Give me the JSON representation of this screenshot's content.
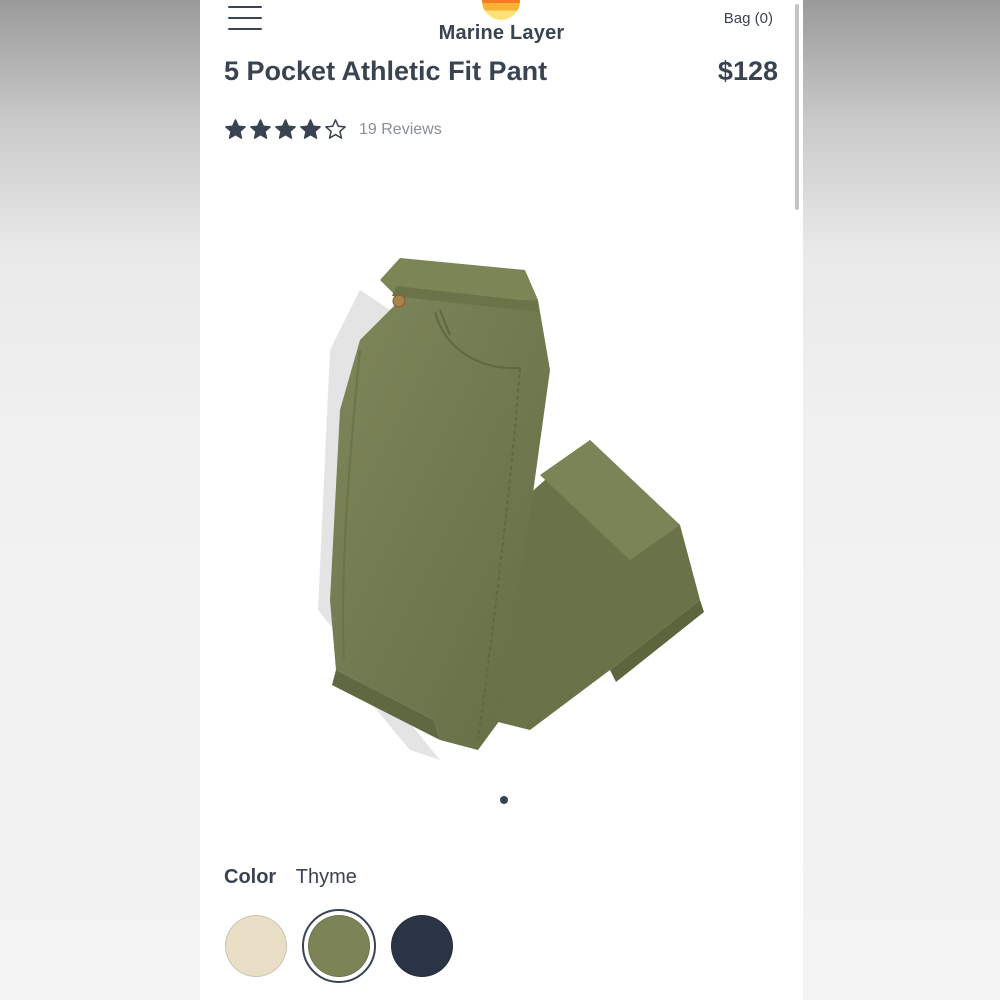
{
  "header": {
    "brand": "Marine Layer",
    "bag_label": "Bag (0)",
    "logo_colors": [
      "#e2322a",
      "#f47b22",
      "#f9b233",
      "#fde27a"
    ]
  },
  "product": {
    "title": "5 Pocket Athletic Fit Pant",
    "price": "$128",
    "rating": 4,
    "rating_max": 5,
    "reviews_label": "19 Reviews",
    "image_count": 1,
    "current_image": 1
  },
  "color": {
    "label": "Color",
    "selected": "Thyme",
    "swatches": [
      {
        "name": "cream-swatch",
        "hex": "#e9dfc7",
        "selected": false
      },
      {
        "name": "thyme-swatch",
        "hex": "#7c8457",
        "selected": true
      },
      {
        "name": "navy-swatch",
        "hex": "#2b3444",
        "selected": false
      }
    ]
  },
  "theme": {
    "text": "#3a4352",
    "muted": "#8a8f96",
    "pant": "#737c50"
  }
}
